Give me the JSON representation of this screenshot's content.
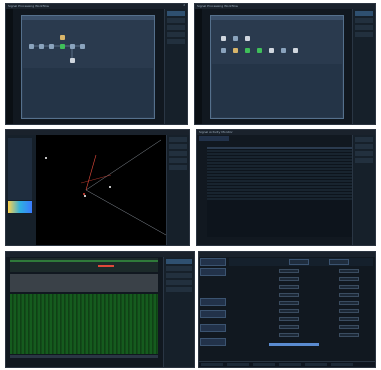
{
  "panels": {
    "p1": {
      "title": "Signal Processing Workflow",
      "tag": "2"
    },
    "p2": {
      "title": "Signal Processing Workflow"
    },
    "p3": {
      "title": ""
    },
    "p4": {
      "title": "Signal Activity Monitor"
    },
    "p5": {
      "title": ""
    },
    "p6": {
      "title": ""
    }
  },
  "colors": {
    "bg": "#111820",
    "accent": "#2f5070",
    "spectrum": "#1f7a2a",
    "waterfall": "#0b3d12",
    "highlight_red": "#e0483a"
  },
  "p6_form": {
    "title": "Signal Analysis Form"
  }
}
